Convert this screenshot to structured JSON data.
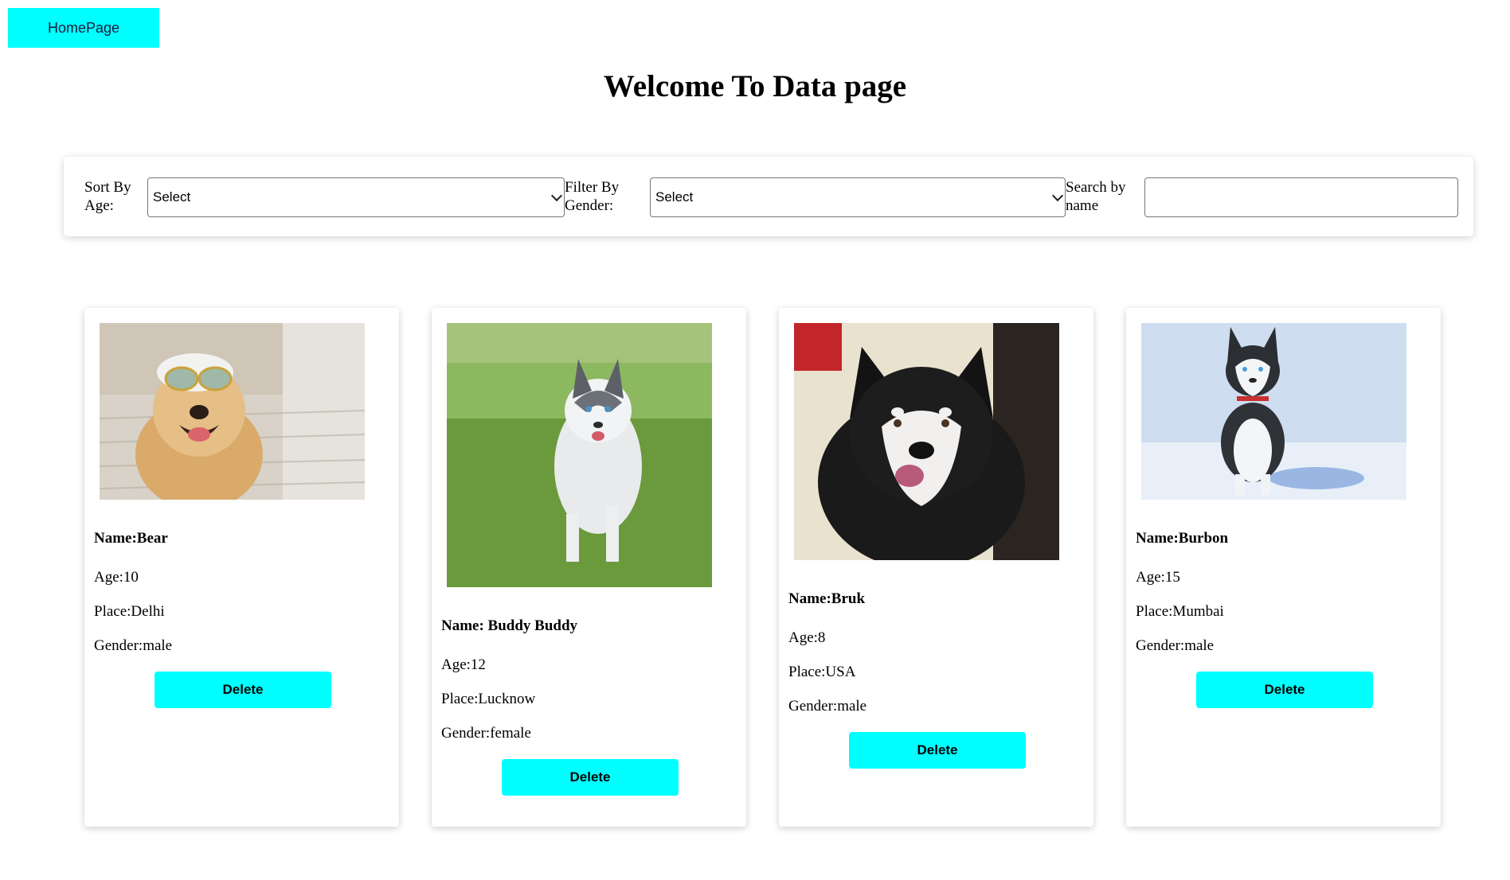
{
  "nav": {
    "home_label": "HomePage"
  },
  "header": {
    "title": "Welcome To Data page"
  },
  "filters": {
    "sort_label": "Sort By Age:",
    "sort_value": "Select",
    "gender_label": "Filter By Gender:",
    "gender_value": "Select",
    "search_label": "Search by name",
    "search_value": ""
  },
  "cards": [
    {
      "name": "Name:Bear",
      "age": "Age:10",
      "place": "Place:Delhi",
      "gender": "Gender:male",
      "delete_label": "Delete"
    },
    {
      "name": "Name: Buddy Buddy",
      "age": "Age:12",
      "place": "Place:Lucknow",
      "gender": "Gender:female",
      "delete_label": "Delete"
    },
    {
      "name": "Name:Bruk",
      "age": "Age:8",
      "place": "Place:USA",
      "gender": "Gender:male",
      "delete_label": "Delete"
    },
    {
      "name": "Name:Burbon",
      "age": "Age:15",
      "place": "Place:Mumbai",
      "gender": "Gender:male",
      "delete_label": "Delete"
    }
  ],
  "colors": {
    "accent": "#00ffff"
  }
}
